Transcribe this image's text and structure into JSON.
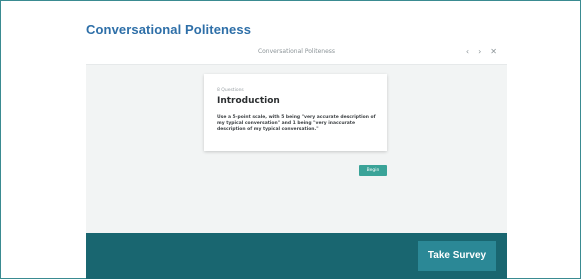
{
  "page": {
    "title": "Conversational Politeness"
  },
  "window": {
    "title": "Conversational Politeness",
    "controls": {
      "prev_icon": "‹",
      "next_icon": "›",
      "close_icon": "✕"
    }
  },
  "card": {
    "count_label": "8 Questions",
    "heading": "Introduction",
    "description": "Use a 5-point scale, with 5 being \"very accurate description of my typical conversation\" and 1 being \"very inaccurate description of my typical conversation.\""
  },
  "actions": {
    "begin_label": "Begin",
    "take_survey_label": "Take Survey"
  },
  "colors": {
    "title_blue": "#2e6fa8",
    "footer_teal": "#196670",
    "button_teal": "#2b8896",
    "begin_green": "#3aa398",
    "frame_border": "#3a8b91"
  },
  "icons": {
    "prev": "chevron-left-icon",
    "next": "chevron-right-icon",
    "close": "close-icon"
  }
}
